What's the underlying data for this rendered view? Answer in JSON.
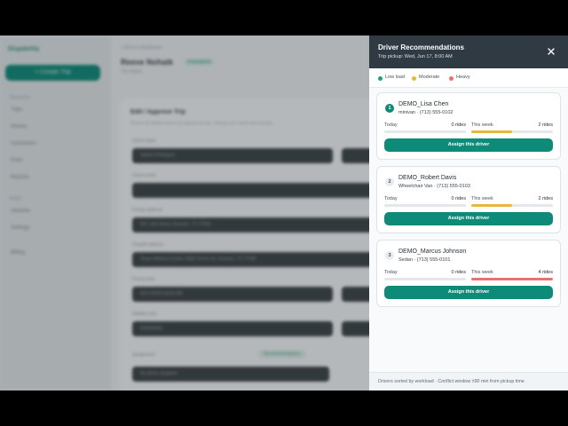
{
  "background_app": {
    "brand": "Dispatchly",
    "new_trip_button": "+ Create Trip",
    "sections": [
      "Operations",
      "Admin"
    ],
    "nav": [
      "Trips",
      "Drivers",
      "Customers",
      "Fleet",
      "Reports",
      "Vehicles",
      "Settings",
      "Billing"
    ],
    "breadcrumb": "< Back to dashboard",
    "page_title": "Reeve Nohaik",
    "status_badge": "Unassigned",
    "page_subtitle": "Trip details",
    "form_title": "Edit / Approve Trip",
    "form_subtitle": "Review the details below and approve the trip. Changes are saved automatically.",
    "fields": [
      {
        "label": "Client name",
        "value": "Valerie Rodriguez"
      },
      {
        "label": "Client email",
        "value": ""
      },
      {
        "label": "Pickup address",
        "value": "591 Oak Street, Houston, TX 77002"
      },
      {
        "label": "Dropoff address",
        "value": "Texas Medical Center, 6565 Fannin St, Houston, TX 77030"
      },
      {
        "label": "Pickup time",
        "value": "06/17/2026 08:00 AM"
      },
      {
        "label": "Mobility type",
        "value": "Ambulatory"
      },
      {
        "label": "Assignment",
        "value": "No driver assigned"
      }
    ],
    "recommend_chip": "Recommendations"
  },
  "drawer": {
    "title": "Driver Recommendations",
    "subtitle": "Trip pickup: Wed, Jun 17, 8:00 AM",
    "close_icon": "close-icon",
    "legend": [
      {
        "label": "Low load",
        "color": "#22a06b"
      },
      {
        "label": "Moderate",
        "color": "#e8b63a"
      },
      {
        "label": "Heavy",
        "color": "#e57373"
      }
    ],
    "drivers": [
      {
        "rank": "1",
        "name": "DEMO_Lisa Chen",
        "meta": "minivan · (713) 555-0102",
        "today_label": "Today",
        "today_value": "0 rides",
        "today_fraction": 0,
        "week_label": "This week",
        "week_value": "2 rides",
        "week_fraction": 0.5,
        "week_color": "#e8b63a",
        "button": "Assign this driver"
      },
      {
        "rank": "2",
        "name": "DEMO_Robert Davis",
        "meta": "Wheelchair Van · (713) 555-0103",
        "today_label": "Today",
        "today_value": "0 rides",
        "today_fraction": 0,
        "week_label": "This week",
        "week_value": "2 rides",
        "week_fraction": 0.5,
        "week_color": "#e8b63a",
        "button": "Assign this driver"
      },
      {
        "rank": "3",
        "name": "DEMO_Marcus Johnson",
        "meta": "Sedan · (713) 555-0101",
        "today_label": "Today",
        "today_value": "0 rides",
        "today_fraction": 0,
        "week_label": "This week",
        "week_value": "4 rides",
        "week_fraction": 1,
        "week_color": "#e57373",
        "button": "Assign this driver"
      }
    ],
    "footer": "Drivers sorted by workload · Conflict window ±90 min from pickup time"
  }
}
